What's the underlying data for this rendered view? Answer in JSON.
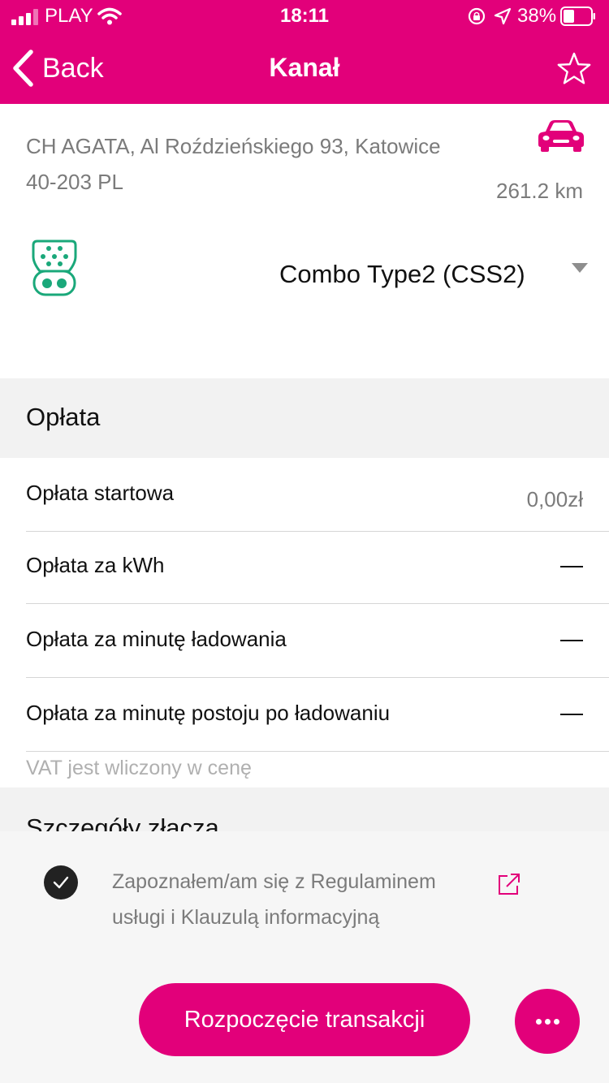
{
  "status_bar": {
    "carrier": "PLAY",
    "time": "18:11",
    "battery": "38%"
  },
  "nav": {
    "back_label": "Back",
    "title": "Kanał"
  },
  "station": {
    "address_line1": "CH AGATA, Al Roździeńskiego 93, Katowice",
    "address_line2": "40-203 PL",
    "distance": "261.2 km"
  },
  "connector": {
    "selected": "Combo Type2 (CSS2)"
  },
  "fees": {
    "section_title": "Opłata",
    "rows": [
      {
        "label": "Opłata startowa",
        "value": "0,00zł"
      },
      {
        "label": "Opłata za kWh",
        "value": ""
      },
      {
        "label": "Opłata za minutę ładowania",
        "value": ""
      },
      {
        "label": "Opłata za minutę postoju po ładowaniu",
        "value": ""
      }
    ],
    "vat_note": "VAT jest wliczony w cenę"
  },
  "details": {
    "section_title": "Szczegóły złącza"
  },
  "footer": {
    "terms_line1": "Zapoznałem/am się z Regulaminem",
    "terms_line2": "usługi i Klauzulą informacyjną",
    "terms_checked": true,
    "start_button": "Rozpoczęcie transakcji"
  },
  "colors": {
    "brand": "#e2007a",
    "connector_icon": "#1aa87a",
    "section_bg": "#f2f2f2"
  }
}
